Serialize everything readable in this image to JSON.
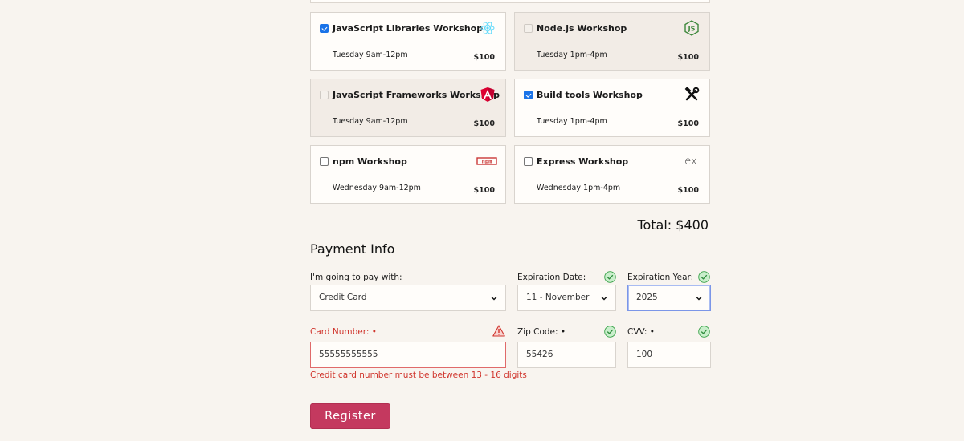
{
  "workshops": [
    {
      "title": "JavaScript Libraries Workshop",
      "time": "Tuesday 9am-12pm",
      "price": "$100",
      "checked": true,
      "disabled": false,
      "icon": "react-icon"
    },
    {
      "title": "Node.js Workshop",
      "time": "Tuesday 1pm-4pm",
      "price": "$100",
      "checked": false,
      "disabled": true,
      "icon": "nodejs-icon"
    },
    {
      "title": "JavaScript Frameworks Workshop",
      "time": "Tuesday 9am-12pm",
      "price": "$100",
      "checked": false,
      "disabled": true,
      "icon": "angular-icon"
    },
    {
      "title": "Build tools Workshop",
      "time": "Tuesday 1pm-4pm",
      "price": "$100",
      "checked": true,
      "disabled": false,
      "icon": "tools-icon"
    },
    {
      "title": "npm Workshop",
      "time": "Wednesday 9am-12pm",
      "price": "$100",
      "checked": false,
      "disabled": false,
      "icon": "npm-icon"
    },
    {
      "title": "Express Workshop",
      "time": "Wednesday 1pm-4pm",
      "price": "$100",
      "checked": false,
      "disabled": false,
      "icon": "express-icon"
    }
  ],
  "total": "Total: $400",
  "payment": {
    "title": "Payment Info",
    "method_label": "I'm going to pay with:",
    "method_value": "Credit Card",
    "exp_date_label": "Expiration Date:",
    "exp_date_value": "11 - November",
    "exp_year_label": "Expiration Year:",
    "exp_year_value": "2025",
    "card_label": "Card Number: •",
    "card_value": "55555555555",
    "zip_label": "Zip Code: •",
    "zip_value": "55426",
    "cvv_label": "CVV: •",
    "cvv_value": "100",
    "card_error": "Credit card number must be between 13 - 16 digits"
  },
  "register_label": "Register",
  "colors": {
    "accent": "#c4395f",
    "error": "#d0342c",
    "valid": "#3aa34a",
    "focus": "#7b96e8"
  }
}
